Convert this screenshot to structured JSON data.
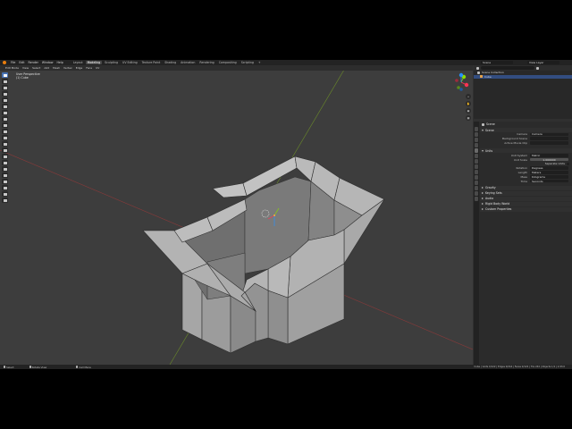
{
  "topbar": {
    "menus": [
      "File",
      "Edit",
      "Render",
      "Window",
      "Help"
    ],
    "workspaces": [
      "Layout",
      "Modeling",
      "Sculpting",
      "UV Editing",
      "Texture Paint",
      "Shading",
      "Animation",
      "Rendering",
      "Compositing",
      "Scripting",
      "+"
    ],
    "active_workspace": "Modeling",
    "scene_label": "Scene",
    "view_layer_label": "View Layer"
  },
  "viewport": {
    "header_items": [
      "Edit Mode",
      "View",
      "Select",
      "Add",
      "Mesh",
      "Vertex",
      "Edge",
      "Face",
      "UV"
    ],
    "info_line1": "User Perspective",
    "info_line2": "(1) Cube",
    "mode_colors": {
      "x_axis": "#ff3352",
      "y_axis": "#8bdc00",
      "z_axis": "#2890ff",
      "mesh_face": "#a8a8a8",
      "mesh_dark": "#7c7c7c",
      "edge": "#3a3a3a",
      "background": "#3d3d3d"
    }
  },
  "outliner": {
    "rows": [
      {
        "label": "Scene Collection",
        "icon": "collection-icon"
      },
      {
        "label": "Cube",
        "icon": "cube-icon",
        "selected": true
      }
    ]
  },
  "properties": {
    "header_title": "Scene",
    "sections": {
      "scene": {
        "title": "Scene",
        "rows": [
          {
            "label": "Camera",
            "value": "Camera"
          },
          {
            "label": "Background Scene",
            "value": ""
          },
          {
            "label": "Active Movie Clip",
            "value": ""
          }
        ]
      },
      "units": {
        "title": "Units",
        "rows": [
          {
            "label": "Unit System",
            "value": "Metric"
          },
          {
            "label": "Unit Scale",
            "value": "1.000000"
          }
        ],
        "separate_units": "Separate Units",
        "rows2": [
          {
            "label": "Rotation",
            "value": "Degrees"
          },
          {
            "label": "Length",
            "value": "Meters"
          },
          {
            "label": "Mass",
            "value": "Kilograms"
          },
          {
            "label": "Time",
            "value": "Seconds"
          }
        ]
      },
      "collapsed": [
        "Gravity",
        "Keying Sets",
        "Audio",
        "Rigid Body World",
        "Custom Properties"
      ]
    }
  },
  "statusbar": {
    "items": [
      "Select",
      "Rotate View",
      "Call Menu"
    ],
    "right_text": "Cube | Verts 0/122 | Edges 0/244 | Faces 0/122 | Tris 244 | Objects 1/1 | 2.93.0"
  }
}
